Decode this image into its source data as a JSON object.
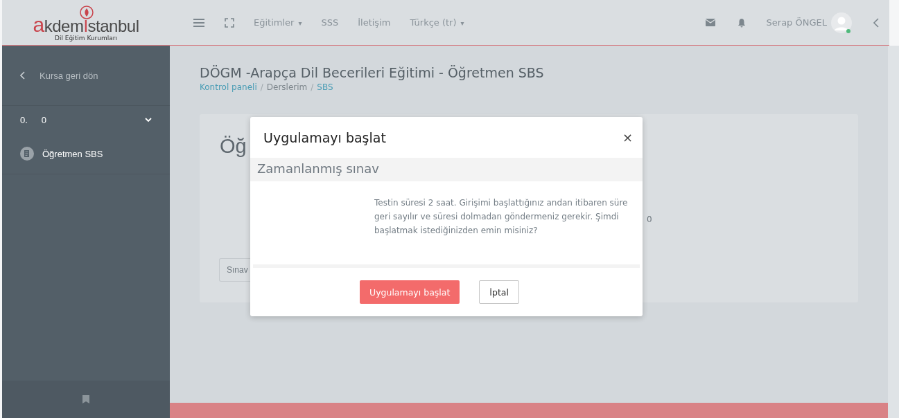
{
  "header": {
    "logo": {
      "brand_a": "a",
      "brand_kdem": "kdem",
      "brand_i": "I",
      "brand_stanbul": "stanbul",
      "subtitle": "Dil Eğitim Kurumları"
    },
    "nav": [
      {
        "label": "Eğitimler",
        "caret": "▾"
      },
      {
        "label": "SSS"
      },
      {
        "label": "İletişim"
      },
      {
        "label": "Türkçe (tr)",
        "caret": "▾"
      }
    ],
    "user": {
      "name": "Serap ÖNGEL",
      "online": true
    }
  },
  "sidebar": {
    "back": "Kursa geri dön",
    "section": {
      "number": "0.",
      "title": "0",
      "expanded": true
    },
    "items": [
      {
        "label": "Öğretmen SBS"
      }
    ]
  },
  "page": {
    "title": "DÖGM -Arapça Dil Becerileri Eğitimi - Öğretmen SBS",
    "breadcrumb": [
      {
        "label": "Kontrol paneli",
        "link": true
      },
      {
        "separator": "/",
        "label": "Derslerim",
        "link": false
      },
      {
        "separator": "/",
        "label": "SBS",
        "link": true
      }
    ],
    "card": {
      "heading": "Öğ",
      "side_text": "0",
      "button": "Sınav"
    }
  },
  "modal": {
    "title": "Uygulamayı başlat",
    "section": "Zamanlanmış sınav",
    "message": "Testin süresi 2 saat. Girişimi başlattığınız andan itibaren süre geri sayılır ve süresi dolmadan göndermeniz gerekir. Şimdi başlatmak istediğinizden emin misiniz?",
    "close": "×",
    "buttons": [
      {
        "label": "Uygulamayı başlat",
        "primary": true
      },
      {
        "label": "İptal",
        "primary": false
      }
    ]
  }
}
